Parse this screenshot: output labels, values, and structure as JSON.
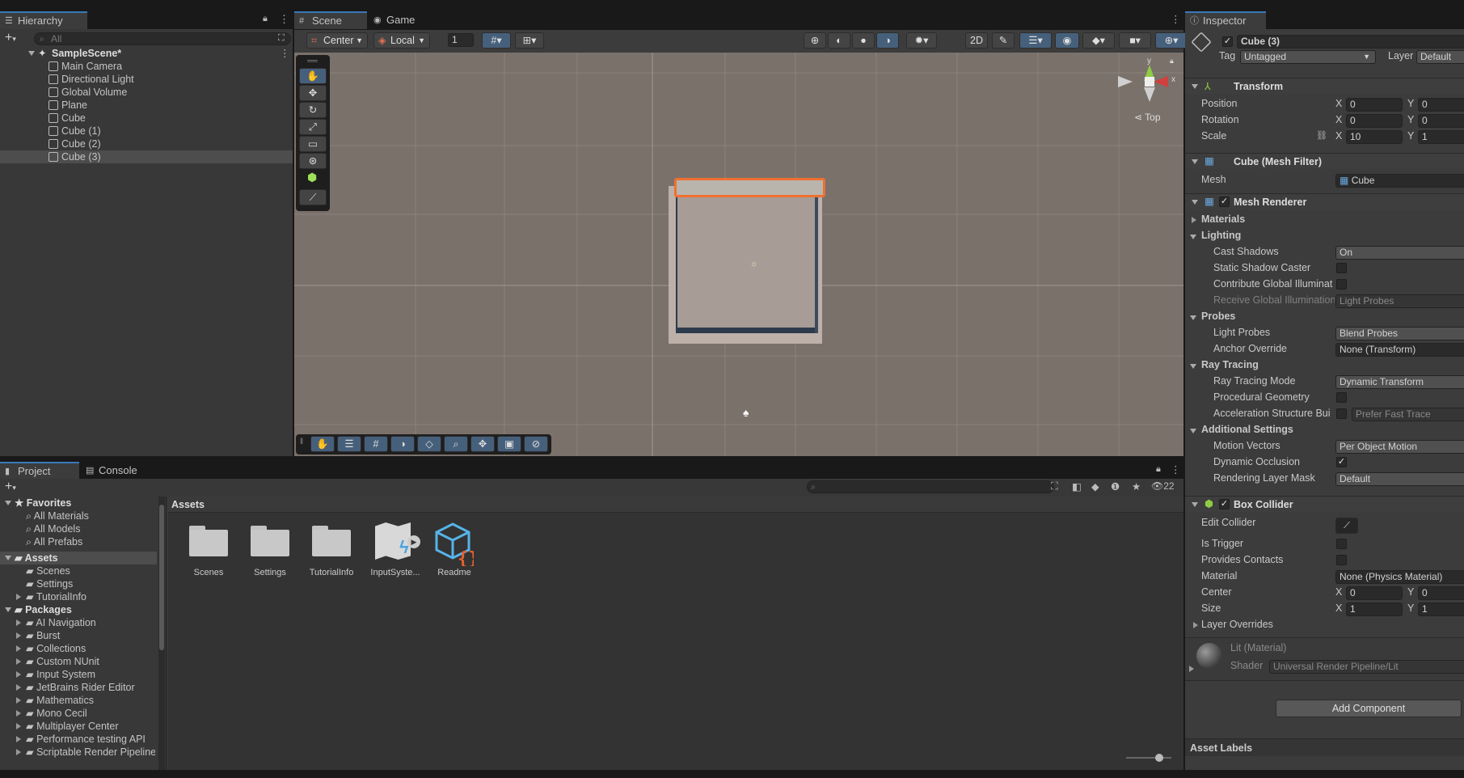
{
  "hierarchy": {
    "tab": "Hierarchy",
    "search_placeholder": "All",
    "scene": "SampleScene*",
    "items": [
      "Main Camera",
      "Directional Light",
      "Global Volume",
      "Plane",
      "Cube",
      "Cube (1)",
      "Cube (2)",
      "Cube (3)"
    ]
  },
  "scene_view": {
    "tabs": [
      "Scene",
      "Game"
    ],
    "pivot": "Center",
    "space": "Local",
    "grid_snap": "1",
    "view_label": "Top",
    "axis_y": "y",
    "axis_x": "x"
  },
  "project": {
    "tabs": [
      "Project",
      "Console"
    ],
    "count": "22",
    "breadcrumb": "Assets",
    "favorites_label": "Favorites",
    "favorites": [
      "All Materials",
      "All Models",
      "All Prefabs"
    ],
    "assets_label": "Assets",
    "asset_folders": [
      "Scenes",
      "Settings",
      "TutorialInfo"
    ],
    "packages_label": "Packages",
    "packages": [
      "AI Navigation",
      "Burst",
      "Collections",
      "Custom NUnit",
      "Input System",
      "JetBrains Rider Editor",
      "Mathematics",
      "Mono Cecil",
      "Multiplayer Center",
      "Performance testing API",
      "Scriptable Render Pipeline"
    ],
    "grid_items": [
      "Scenes",
      "Settings",
      "TutorialInfo",
      "InputSyste...",
      "Readme"
    ]
  },
  "inspector": {
    "tab": "Inspector",
    "object_name": "Cube (3)",
    "tag_label": "Tag",
    "tag_value": "Untagged",
    "layer_label": "Layer",
    "layer_value": "Default",
    "transform": {
      "title": "Transform",
      "position_label": "Position",
      "rotation_label": "Rotation",
      "scale_label": "Scale",
      "position": {
        "x": "0",
        "y": "0"
      },
      "rotation": {
        "x": "0",
        "y": "0"
      },
      "scale": {
        "x": "10",
        "y": "1"
      }
    },
    "mesh_filter": {
      "title": "Cube (Mesh Filter)",
      "mesh_label": "Mesh",
      "mesh_value": "Cube"
    },
    "mesh_renderer": {
      "title": "Mesh Renderer",
      "materials": "Materials",
      "lighting": "Lighting",
      "cast_shadows_label": "Cast Shadows",
      "cast_shadows": "On",
      "static_shadow": "Static Shadow Caster",
      "contribute_gi": "Contribute Global Illuminat",
      "receive_gi_label": "Receive Global Illumination",
      "receive_gi": "Light Probes",
      "probes": "Probes",
      "light_probes_label": "Light Probes",
      "light_probes": "Blend Probes",
      "anchor_label": "Anchor Override",
      "anchor": "None (Transform)",
      "ray_tracing": "Ray Tracing",
      "rt_mode_label": "Ray Tracing Mode",
      "rt_mode": "Dynamic Transform",
      "procedural": "Procedural Geometry",
      "accel_label": "Acceleration Structure Bui",
      "accel": "Prefer Fast Trace",
      "additional": "Additional Settings",
      "motion_label": "Motion Vectors",
      "motion": "Per Object Motion",
      "dyn_occlusion": "Dynamic Occlusion",
      "render_layer_label": "Rendering Layer Mask",
      "render_layer": "Default"
    },
    "box_collider": {
      "title": "Box Collider",
      "edit_collider": "Edit Collider",
      "is_trigger": "Is Trigger",
      "provides_contacts": "Provides Contacts",
      "material_label": "Material",
      "material": "None (Physics Material)",
      "center_label": "Center",
      "center": {
        "x": "0",
        "y": "0"
      },
      "size_label": "Size",
      "size": {
        "x": "1",
        "y": "1"
      },
      "layer_overrides": "Layer Overrides"
    },
    "material": {
      "name": "Lit (Material)",
      "shader_label": "Shader",
      "shader": "Universal Render Pipeline/Lit"
    },
    "add_component": "Add Component",
    "asset_labels": "Asset Labels",
    "x": "X",
    "y": "Y"
  }
}
